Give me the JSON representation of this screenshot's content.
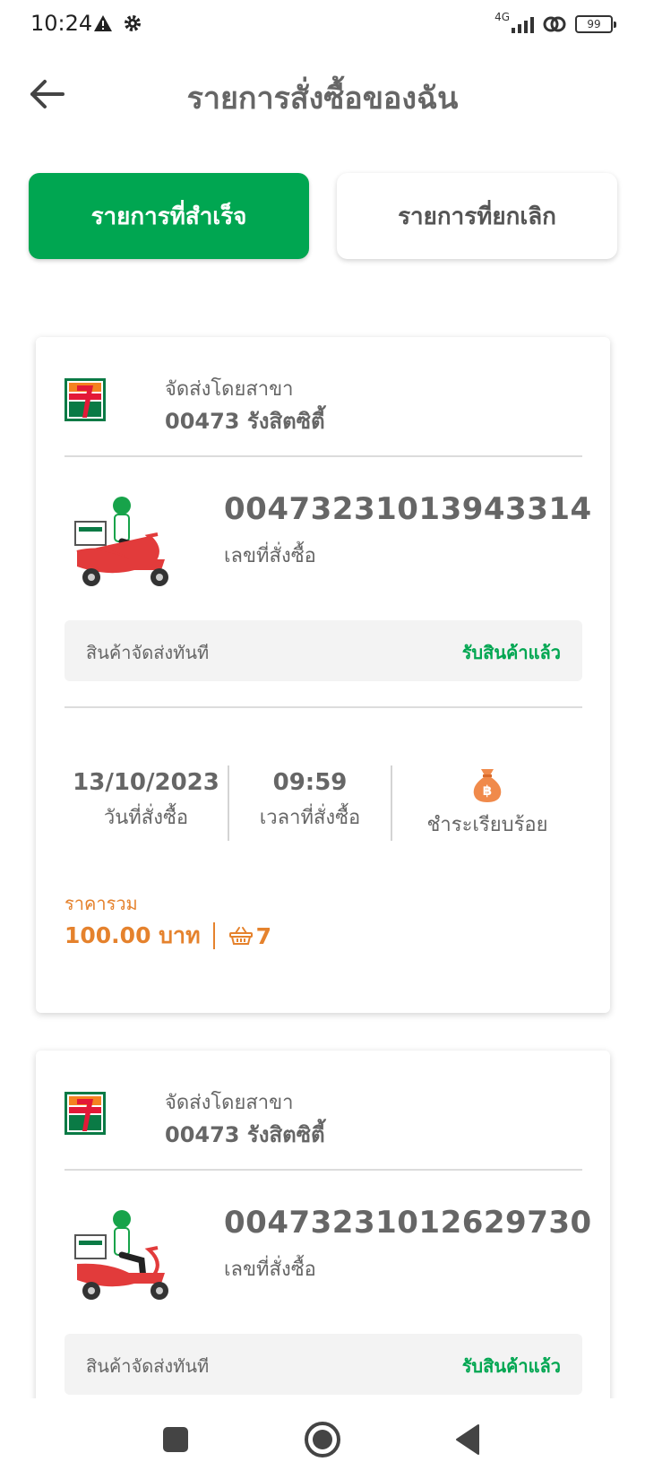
{
  "status_bar": {
    "time": "10:24",
    "network": "4G",
    "battery": "99"
  },
  "header": {
    "title": "รายการสั่งซื้อของฉัน",
    "back_icon": "arrow-left-icon"
  },
  "tabs": [
    {
      "label": "รายการที่สำเร็จ",
      "active": true
    },
    {
      "label": "รายการที่ยกเลิก",
      "active": false
    }
  ],
  "colors": {
    "brand_green": "#00a651",
    "price_orange": "#e5822d",
    "text_gray": "#666666"
  },
  "orders": [
    {
      "branch_label": "จัดส่งโดยสาขา",
      "branch_name": "00473 รังสิตซิตี้",
      "order_number": "00473231013943314",
      "order_number_label": "เลขที่สั่งซื้อ",
      "delivery_type": "สินค้าจัดส่งทันที",
      "delivery_status": "รับสินค้าแล้ว",
      "order_date": "13/10/2023",
      "order_date_label": "วันที่สั่งซื้อ",
      "order_time": "09:59",
      "order_time_label": "เวลาที่สั่งซื้อ",
      "payment_status": "ชำระเรียบร้อย",
      "total_label": "ราคารวม",
      "total_price": "100.00 บาท",
      "item_count": "7"
    },
    {
      "branch_label": "จัดส่งโดยสาขา",
      "branch_name": "00473 รังสิตซิตี้",
      "order_number": "00473231012629730",
      "order_number_label": "เลขที่สั่งซื้อ",
      "delivery_type": "สินค้าจัดส่งทันที",
      "delivery_status": "รับสินค้าแล้ว"
    }
  ]
}
